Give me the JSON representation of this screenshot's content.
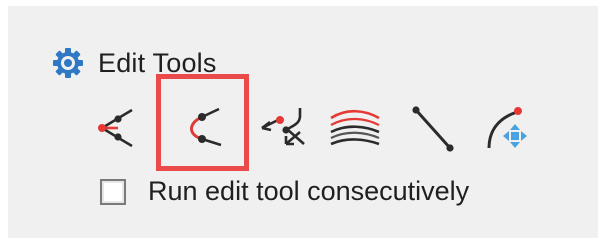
{
  "panel": {
    "title": "Edit Tools",
    "header_icon": "gear-icon",
    "accent_color": "#2f78c4",
    "highlight_color": "#ea4a4a"
  },
  "tools": [
    {
      "icon": "extend-line-icon",
      "selected": false
    },
    {
      "icon": "trim-curve-icon",
      "selected": true
    },
    {
      "icon": "break-connect-icon",
      "selected": false
    },
    {
      "icon": "parallel-lines-icon",
      "selected": false
    },
    {
      "icon": "straight-line-icon",
      "selected": false
    },
    {
      "icon": "move-arc-icon",
      "selected": false
    }
  ],
  "options": {
    "consecutive": {
      "label": "Run edit tool consecutively",
      "checked": false
    }
  }
}
